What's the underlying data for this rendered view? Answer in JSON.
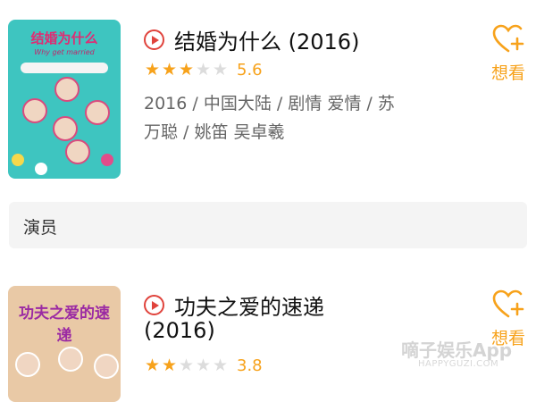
{
  "movies": [
    {
      "title": "结婚为什么 (2016)",
      "rating": 5.6,
      "rating_text": "5.6",
      "stars_filled": 3,
      "stars_total": 5,
      "meta_line1": "2016 / 中国大陆 / 剧情 爱情 / 苏",
      "meta_line2": "万聪 / 姚笛 吴卓羲",
      "want_label": "想看",
      "poster_title": "结婚为什么",
      "poster_subtitle": "Why get married"
    },
    {
      "title_line1": "功夫之爱的速递",
      "title_line2": "(2016)",
      "rating": 3.8,
      "rating_text": "3.8",
      "stars_filled": 2,
      "stars_total": 5,
      "want_label": "想看",
      "poster_title": "功夫之爱的速递"
    }
  ],
  "section": {
    "title": "演员"
  },
  "watermark": {
    "text": "嘀子娱乐App",
    "sub": "HAPPYGUZI.COM"
  },
  "colors": {
    "accent": "#f7a21b",
    "play": "#e0433c",
    "meta": "#666666",
    "section_bg": "#f4f4f4"
  },
  "icons": {
    "play": "play-circle-icon",
    "want": "heart-plus-icon",
    "star": "star-icon"
  }
}
